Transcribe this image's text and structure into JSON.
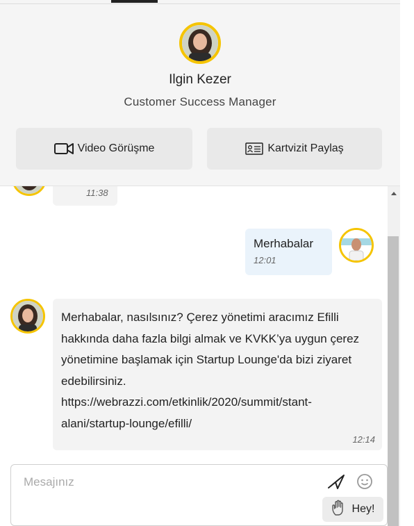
{
  "profile": {
    "name": "Ilgin Kezer",
    "title": "Customer Success Manager",
    "video_button": "Video Görüşme",
    "card_button": "Kartvizit Paylaş"
  },
  "messages": [
    {
      "sender": "agent",
      "time": "11:38"
    },
    {
      "sender": "user",
      "text": "Merhabalar",
      "time": "12:01"
    },
    {
      "sender": "agent",
      "text": "Merhabalar, nasılsınız? Çerez yönetimi aracımız Efilli hakkında daha fazla bilgi almak ve KVKK’ya uygun çerez yönetimine başlamak için Startup Lounge'da bizi ziyaret edebilirsiniz. https://webrazzi.com/etkinlik/2020/summit/stant-alani/startup-lounge/efilli/",
      "time": "12:14"
    }
  ],
  "composer": {
    "placeholder": "Mesajınız",
    "quick_reply": "Hey!"
  },
  "colors": {
    "avatar_ring": "#f5c400",
    "outgoing_bubble": "#eaf3fb",
    "incoming_bubble": "#f3f3f3"
  },
  "icons": [
    "video-camera-icon",
    "contact-card-icon",
    "send-icon",
    "emoji-icon",
    "wave-hand-icon"
  ]
}
